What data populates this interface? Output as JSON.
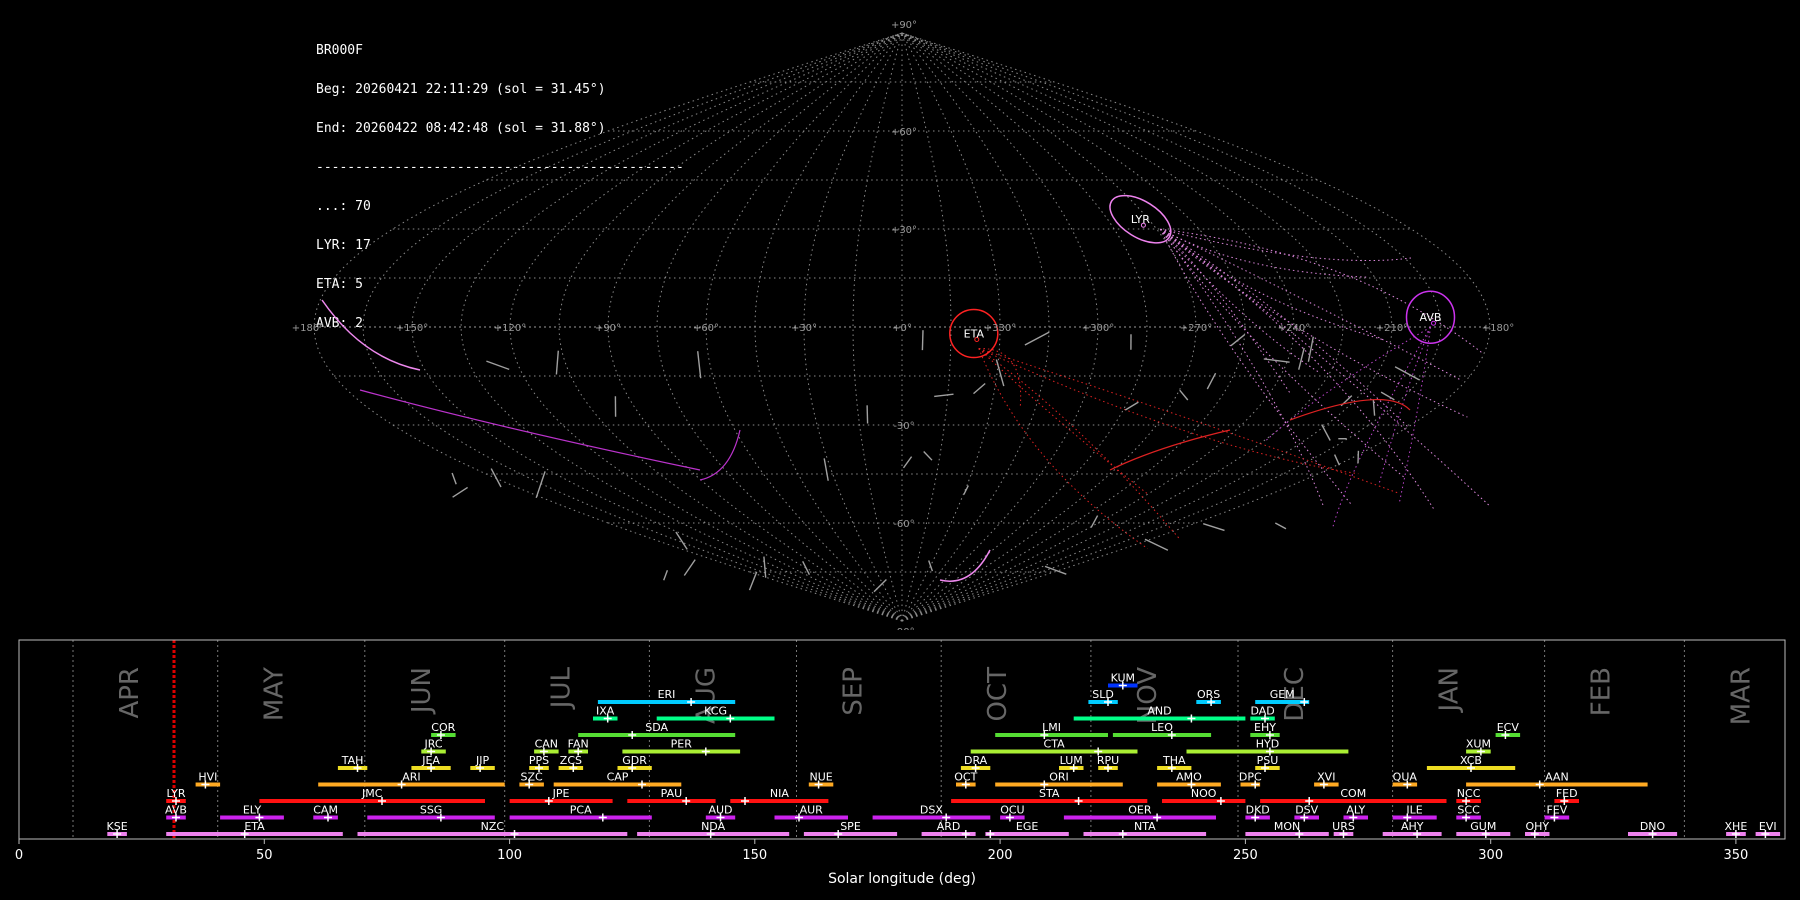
{
  "info": {
    "station": "BR000F",
    "begin": "Beg: 20260421 22:11:29 (sol = 31.45°)",
    "end": "End: 20260422 08:42:48 (sol = 31.88°)",
    "separator": "-----------------------------------------------",
    "counts": [
      "...: 70",
      "LYR: 17",
      "ETA: 5",
      "AVB: 2"
    ]
  },
  "chart_data": [
    {
      "type": "scatter",
      "projection": "sinusoidal",
      "lon_ticks": [
        "+180°",
        "+150°",
        "+120°",
        "+90°",
        "+60°",
        "+30°",
        "+0°",
        "+330°",
        "+300°",
        "+270°",
        "+240°",
        "+210°",
        "+180°"
      ],
      "lat_ticks": [
        "+90°",
        "+60°",
        "+30°",
        "+0°",
        "-30°",
        "-60°",
        "-90°"
      ],
      "radiants": [
        {
          "name": "LYR",
          "ra": 273,
          "dec": 33,
          "color": "#ee82ee"
        },
        {
          "name": "ETA",
          "ra": 338,
          "dec": -2,
          "color": "#ff2222"
        },
        {
          "name": "AVB",
          "ra": 198,
          "dec": 3,
          "color": "#cc33ee"
        }
      ]
    },
    {
      "type": "bar",
      "xlabel": "Solar longitude (deg)",
      "xlim": [
        0,
        360
      ],
      "x_ticks": [
        0,
        50,
        100,
        150,
        200,
        250,
        300,
        350
      ],
      "current_sol": 31.6,
      "months": [
        {
          "name": "APR",
          "start": 11
        },
        {
          "name": "MAY",
          "start": 40.5
        },
        {
          "name": "JUN",
          "start": 70.5
        },
        {
          "name": "JUL",
          "start": 99
        },
        {
          "name": "AUG",
          "start": 128.5
        },
        {
          "name": "SEP",
          "start": 158.5
        },
        {
          "name": "OCT",
          "start": 188
        },
        {
          "name": "NOV",
          "start": 218.5
        },
        {
          "name": "DEC",
          "start": 248.5
        },
        {
          "name": "JAN",
          "start": 280
        },
        {
          "name": "FEB",
          "start": 311
        },
        {
          "name": "MAR",
          "start": 339.5
        }
      ],
      "showers": [
        {
          "name": "KUM",
          "start": 222,
          "end": 228,
          "peak": 225,
          "row": 9,
          "color": "#0033ff"
        },
        {
          "name": "ERI",
          "start": 118,
          "end": 146,
          "peak": 137,
          "row": 8,
          "color": "#00ccff"
        },
        {
          "name": "SLD",
          "start": 218,
          "end": 224,
          "peak": 222,
          "row": 8,
          "color": "#00ccff"
        },
        {
          "name": "ORS",
          "start": 240,
          "end": 245,
          "peak": 243,
          "row": 8,
          "color": "#00ccff"
        },
        {
          "name": "GEM",
          "start": 252,
          "end": 263,
          "peak": 262,
          "row": 8,
          "color": "#00ccff"
        },
        {
          "name": "IXA",
          "start": 117,
          "end": 122,
          "peak": 120,
          "row": 7,
          "color": "#00ff88"
        },
        {
          "name": "KCG",
          "start": 130,
          "end": 154,
          "peak": 145,
          "row": 7,
          "color": "#00ff88"
        },
        {
          "name": "AND",
          "start": 215,
          "end": 250,
          "peak": 239,
          "row": 7,
          "color": "#00ff88"
        },
        {
          "name": "DAD",
          "start": 251,
          "end": 256,
          "peak": 254,
          "row": 7,
          "color": "#00ff88"
        },
        {
          "name": "COR",
          "start": 84,
          "end": 89,
          "peak": 86,
          "row": 6,
          "color": "#55dd33"
        },
        {
          "name": "SDA",
          "start": 114,
          "end": 146,
          "peak": 125,
          "row": 6,
          "color": "#55dd33"
        },
        {
          "name": "LMI",
          "start": 199,
          "end": 222,
          "peak": 209,
          "row": 6,
          "color": "#55dd33"
        },
        {
          "name": "LEO",
          "start": 223,
          "end": 243,
          "peak": 235,
          "row": 6,
          "color": "#55dd33"
        },
        {
          "name": "EHY",
          "start": 251,
          "end": 257,
          "peak": 255,
          "row": 6,
          "color": "#55dd33"
        },
        {
          "name": "ECV",
          "start": 301,
          "end": 306,
          "peak": 303,
          "row": 6,
          "color": "#55dd33"
        },
        {
          "name": "JRC",
          "start": 82,
          "end": 87,
          "peak": 84,
          "row": 5,
          "color": "#aaee33"
        },
        {
          "name": "CAN",
          "start": 105,
          "end": 110,
          "peak": 107,
          "row": 5,
          "color": "#aaee33"
        },
        {
          "name": "FAN",
          "start": 112,
          "end": 116,
          "peak": 114,
          "row": 5,
          "color": "#aaee33"
        },
        {
          "name": "PER",
          "start": 123,
          "end": 147,
          "peak": 140,
          "row": 5,
          "color": "#aaee33"
        },
        {
          "name": "CTA",
          "start": 194,
          "end": 228,
          "peak": 220,
          "row": 5,
          "color": "#aaee33"
        },
        {
          "name": "HYD",
          "start": 238,
          "end": 271,
          "peak": 255,
          "row": 5,
          "color": "#aaee33"
        },
        {
          "name": "XUM",
          "start": 295,
          "end": 300,
          "peak": 298,
          "row": 5,
          "color": "#aaee33"
        },
        {
          "name": "TAH",
          "start": 65,
          "end": 71,
          "peak": 69,
          "row": 4,
          "color": "#eedd22"
        },
        {
          "name": "JEA",
          "start": 80,
          "end": 88,
          "peak": 84,
          "row": 4,
          "color": "#eedd22"
        },
        {
          "name": "JIP",
          "start": 92,
          "end": 97,
          "peak": 94,
          "row": 4,
          "color": "#eedd22"
        },
        {
          "name": "PPS",
          "start": 104,
          "end": 108,
          "peak": 106,
          "row": 4,
          "color": "#eedd22"
        },
        {
          "name": "ZCS",
          "start": 110,
          "end": 115,
          "peak": 113,
          "row": 4,
          "color": "#eedd22"
        },
        {
          "name": "GDR",
          "start": 122,
          "end": 129,
          "peak": 125,
          "row": 4,
          "color": "#eedd22"
        },
        {
          "name": "DRA",
          "start": 192,
          "end": 198,
          "peak": 195,
          "row": 4,
          "color": "#eedd22"
        },
        {
          "name": "LUM",
          "start": 212,
          "end": 217,
          "peak": 215,
          "row": 4,
          "color": "#eedd22"
        },
        {
          "name": "RPU",
          "start": 220,
          "end": 224,
          "peak": 222,
          "row": 4,
          "color": "#eedd22"
        },
        {
          "name": "THA",
          "start": 232,
          "end": 239,
          "peak": 235,
          "row": 4,
          "color": "#eedd22"
        },
        {
          "name": "PSU",
          "start": 252,
          "end": 257,
          "peak": 254,
          "row": 4,
          "color": "#eedd22"
        },
        {
          "name": "XCB",
          "start": 287,
          "end": 305,
          "peak": 296,
          "row": 4,
          "color": "#eedd22"
        },
        {
          "name": "HVI",
          "start": 36,
          "end": 41,
          "peak": 38,
          "row": 3,
          "color": "#ffaa22"
        },
        {
          "name": "ARI",
          "start": 61,
          "end": 99,
          "peak": 78,
          "row": 3,
          "color": "#ffaa22"
        },
        {
          "name": "SZC",
          "start": 102,
          "end": 107,
          "peak": 104,
          "row": 3,
          "color": "#ffaa22"
        },
        {
          "name": "CAP",
          "start": 109,
          "end": 135,
          "peak": 127,
          "row": 3,
          "color": "#ffaa22"
        },
        {
          "name": "NUE",
          "start": 161,
          "end": 166,
          "peak": 163,
          "row": 3,
          "color": "#ffaa22"
        },
        {
          "name": "OCT",
          "start": 191,
          "end": 195,
          "peak": 193,
          "row": 3,
          "color": "#ffaa22"
        },
        {
          "name": "ORI",
          "start": 199,
          "end": 225,
          "peak": 209,
          "row": 3,
          "color": "#ffaa22"
        },
        {
          "name": "AMO",
          "start": 232,
          "end": 245,
          "peak": 239,
          "row": 3,
          "color": "#ffaa22"
        },
        {
          "name": "DPC",
          "start": 249,
          "end": 253,
          "peak": 252,
          "row": 3,
          "color": "#ffaa22"
        },
        {
          "name": "XVI",
          "start": 264,
          "end": 269,
          "peak": 266,
          "row": 3,
          "color": "#ffaa22"
        },
        {
          "name": "QUA",
          "start": 280,
          "end": 285,
          "peak": 283,
          "row": 3,
          "color": "#ffaa22"
        },
        {
          "name": "AAN",
          "start": 295,
          "end": 332,
          "peak": 310,
          "row": 3,
          "color": "#ffaa22"
        },
        {
          "name": "LYR",
          "start": 30,
          "end": 34,
          "peak": 32,
          "row": 2,
          "color": "#ff1111"
        },
        {
          "name": "JMC",
          "start": 49,
          "end": 95,
          "peak": 74,
          "row": 2,
          "color": "#ff1111"
        },
        {
          "name": "JPE",
          "start": 100,
          "end": 121,
          "peak": 108,
          "row": 2,
          "color": "#ff1111"
        },
        {
          "name": "PAU",
          "start": 124,
          "end": 142,
          "peak": 136,
          "row": 2,
          "color": "#ff1111"
        },
        {
          "name": "NIA",
          "start": 145,
          "end": 165,
          "peak": 148,
          "row": 2,
          "color": "#ff1111"
        },
        {
          "name": "STA",
          "start": 190,
          "end": 230,
          "peak": 216,
          "row": 2,
          "color": "#ff1111"
        },
        {
          "name": "NOO",
          "start": 233,
          "end": 250,
          "peak": 245,
          "row": 2,
          "color": "#ff1111"
        },
        {
          "name": "COM",
          "start": 253,
          "end": 291,
          "peak": 263,
          "row": 2,
          "color": "#ff1111"
        },
        {
          "name": "NCC",
          "start": 293,
          "end": 298,
          "peak": 295,
          "row": 2,
          "color": "#ff1111"
        },
        {
          "name": "FED",
          "start": 313,
          "end": 318,
          "peak": 315,
          "row": 2,
          "color": "#ff1111"
        },
        {
          "name": "AVB",
          "start": 30,
          "end": 34,
          "peak": 32,
          "row": 1,
          "color": "#cc22ee"
        },
        {
          "name": "ELY",
          "start": 41,
          "end": 54,
          "peak": 49,
          "row": 1,
          "color": "#cc22ee"
        },
        {
          "name": "CAM",
          "start": 60,
          "end": 65,
          "peak": 63,
          "row": 1,
          "color": "#cc22ee"
        },
        {
          "name": "SSG",
          "start": 71,
          "end": 97,
          "peak": 86,
          "row": 1,
          "color": "#cc22ee"
        },
        {
          "name": "PCA",
          "start": 100,
          "end": 129,
          "peak": 119,
          "row": 1,
          "color": "#cc22ee"
        },
        {
          "name": "AUD",
          "start": 140,
          "end": 146,
          "peak": 143,
          "row": 1,
          "color": "#cc22ee"
        },
        {
          "name": "AUR",
          "start": 154,
          "end": 169,
          "peak": 159,
          "row": 1,
          "color": "#cc22ee"
        },
        {
          "name": "DSX",
          "start": 174,
          "end": 198,
          "peak": 189,
          "row": 1,
          "color": "#cc22ee"
        },
        {
          "name": "OCU",
          "start": 200,
          "end": 205,
          "peak": 202,
          "row": 1,
          "color": "#cc22ee"
        },
        {
          "name": "OER",
          "start": 213,
          "end": 244,
          "peak": 232,
          "row": 1,
          "color": "#cc22ee"
        },
        {
          "name": "DKD",
          "start": 250,
          "end": 255,
          "peak": 252,
          "row": 1,
          "color": "#cc22ee"
        },
        {
          "name": "DSV",
          "start": 260,
          "end": 265,
          "peak": 262,
          "row": 1,
          "color": "#cc22ee"
        },
        {
          "name": "ALY",
          "start": 270,
          "end": 275,
          "peak": 272,
          "row": 1,
          "color": "#cc22ee"
        },
        {
          "name": "ILE",
          "start": 280,
          "end": 289,
          "peak": 283,
          "row": 1,
          "color": "#cc22ee"
        },
        {
          "name": "SCC",
          "start": 293,
          "end": 298,
          "peak": 295,
          "row": 1,
          "color": "#cc22ee"
        },
        {
          "name": "FEV",
          "start": 311,
          "end": 316,
          "peak": 313,
          "row": 1,
          "color": "#cc22ee"
        },
        {
          "name": "KSE",
          "start": 18,
          "end": 22,
          "peak": 20,
          "row": 0,
          "color": "#ee82ee"
        },
        {
          "name": "ETA",
          "start": 30,
          "end": 66,
          "peak": 46,
          "row": 0,
          "color": "#ee82ee"
        },
        {
          "name": "NZC",
          "start": 69,
          "end": 124,
          "peak": 101,
          "row": 0,
          "color": "#ee82ee"
        },
        {
          "name": "NDA",
          "start": 126,
          "end": 157,
          "peak": 141,
          "row": 0,
          "color": "#ee82ee"
        },
        {
          "name": "SPE",
          "start": 160,
          "end": 179,
          "peak": 167,
          "row": 0,
          "color": "#ee82ee"
        },
        {
          "name": "ARD",
          "start": 184,
          "end": 195,
          "peak": 193,
          "row": 0,
          "color": "#ee82ee"
        },
        {
          "name": "EGE",
          "start": 197,
          "end": 214,
          "peak": 198,
          "row": 0,
          "color": "#ee82ee"
        },
        {
          "name": "NTA",
          "start": 217,
          "end": 242,
          "peak": 225,
          "row": 0,
          "color": "#ee82ee"
        },
        {
          "name": "MON",
          "start": 250,
          "end": 267,
          "peak": 261,
          "row": 0,
          "color": "#ee82ee"
        },
        {
          "name": "URS",
          "start": 268,
          "end": 272,
          "peak": 270,
          "row": 0,
          "color": "#ee82ee"
        },
        {
          "name": "AHY",
          "start": 278,
          "end": 290,
          "peak": 285,
          "row": 0,
          "color": "#ee82ee"
        },
        {
          "name": "GUM",
          "start": 293,
          "end": 304,
          "peak": 299,
          "row": 0,
          "color": "#ee82ee"
        },
        {
          "name": "OHY",
          "start": 307,
          "end": 312,
          "peak": 309,
          "row": 0,
          "color": "#ee82ee"
        },
        {
          "name": "DNO",
          "start": 328,
          "end": 338,
          "peak": 333,
          "row": 0,
          "color": "#ee82ee"
        },
        {
          "name": "XHE",
          "start": 348,
          "end": 352,
          "peak": 350,
          "row": 0,
          "color": "#ee82ee"
        },
        {
          "name": "EVI",
          "start": 354,
          "end": 359,
          "peak": 356,
          "row": 0,
          "color": "#ee82ee"
        }
      ]
    }
  ]
}
